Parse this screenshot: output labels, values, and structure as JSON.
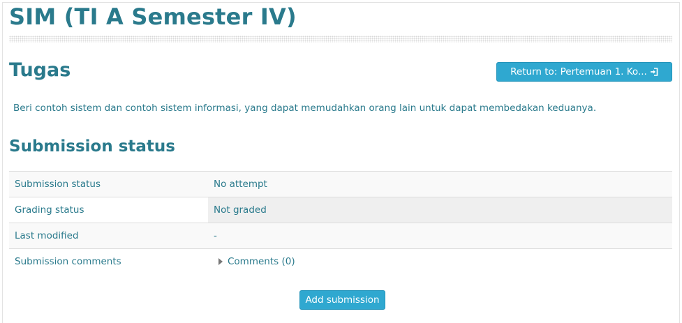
{
  "course": {
    "title": "SIM (TI A Semester IV)"
  },
  "assignment": {
    "heading": "Tugas",
    "return_label": "Return to: Pertemuan 1. Ko...",
    "description": "Beri contoh sistem dan contoh sistem informasi,  yang dapat memudahkan orang lain untuk dapat membedakan keduanya."
  },
  "submission": {
    "heading": "Submission status",
    "rows": [
      {
        "label": "Submission status",
        "value": "No attempt"
      },
      {
        "label": "Grading status",
        "value": "Not graded"
      },
      {
        "label": "Last modified",
        "value": "-"
      },
      {
        "label": "Submission comments",
        "value": "Comments (0)"
      }
    ],
    "add_label": "Add submission"
  },
  "icons": {
    "return": "sign-in-icon",
    "toggle": "caret-right-icon"
  },
  "colors": {
    "accent": "#2fa8d0",
    "heading": "#2a7a8c"
  }
}
